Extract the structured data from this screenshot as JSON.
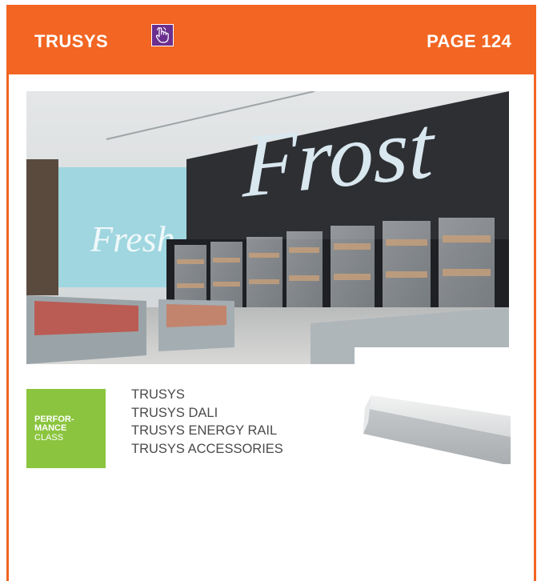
{
  "header": {
    "title": "TRUSYS",
    "page_label": "PAGE 124",
    "hand_icon": "pointing-hand-icon"
  },
  "photo": {
    "sign_large": "Frost",
    "sign_small": "Fresh"
  },
  "badge": {
    "line1": "PERFOR-",
    "line2": "MANCE",
    "line3": "CLASS"
  },
  "products": [
    "TRUSYS",
    "TRUSYS DALI",
    "TRUSYS ENERGY RAIL",
    "TRUSYS ACCESSORIES"
  ],
  "colors": {
    "accent": "#f26522",
    "badge_green": "#8bc53f",
    "button_purple": "#6b2f8e"
  }
}
